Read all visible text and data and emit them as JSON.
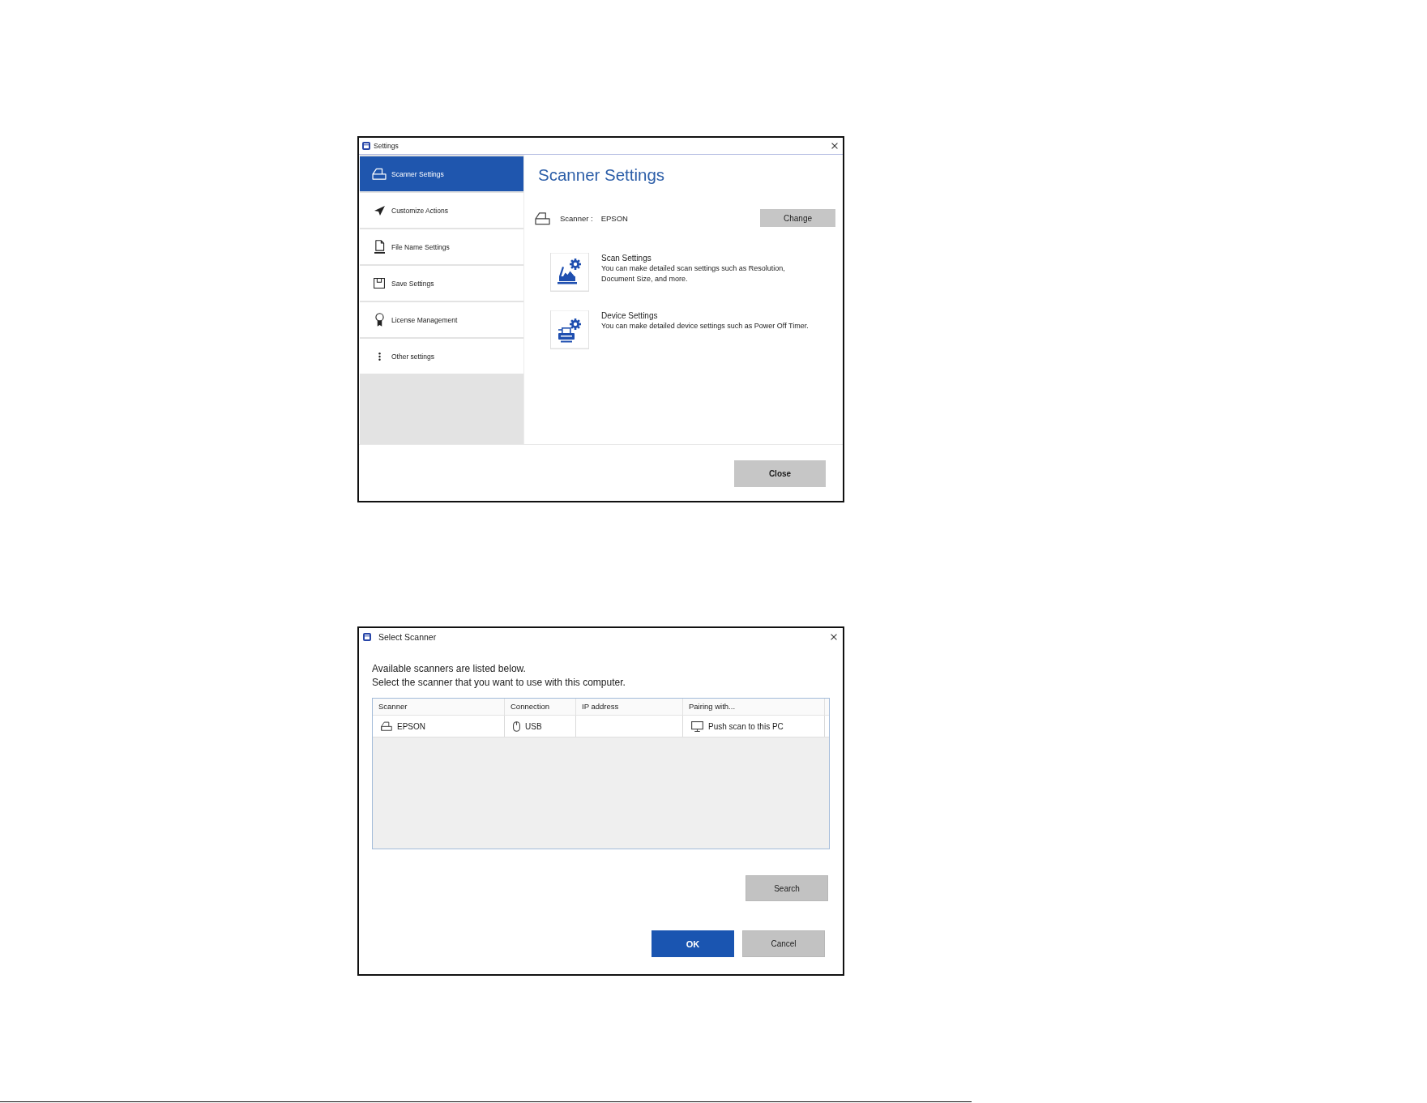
{
  "settings_window": {
    "title": "Settings",
    "sidebar": {
      "items": [
        {
          "kind": "scanner",
          "label": "Scanner Settings",
          "selected": true
        },
        {
          "kind": "actions",
          "label": "Customize Actions",
          "selected": false
        },
        {
          "kind": "file",
          "label": "File Name Settings",
          "selected": false
        },
        {
          "kind": "save",
          "label": "Save Settings",
          "selected": false
        },
        {
          "kind": "license",
          "label": "License Management",
          "selected": false
        },
        {
          "kind": "more",
          "label": "Other settings",
          "selected": false
        }
      ]
    },
    "heading": "Scanner Settings",
    "scanner": {
      "label": "Scanner :",
      "value": "EPSON"
    },
    "change_button": "Change",
    "options": [
      {
        "kind": "scan",
        "title": "Scan Settings",
        "description": "You can make detailed scan settings such as Resolution,\nDocument Size, and more."
      },
      {
        "kind": "device",
        "title": "Device Settings",
        "description": "You can make detailed device settings such as Power Off Timer."
      }
    ],
    "close_button": "Close"
  },
  "select_scanner_window": {
    "title": "Select Scanner",
    "instructions": [
      "Available scanners are listed below.",
      "Select the scanner that you want to use with this computer."
    ],
    "table": {
      "columns": [
        "Scanner",
        "Connection",
        "IP address",
        "Pairing with..."
      ],
      "rows": [
        {
          "scanner": "EPSON",
          "connection": "USB",
          "pairing": "Push scan to this PC",
          "selected": false
        }
      ]
    },
    "search_button": "Search",
    "buttons": [
      {
        "kind": "primary",
        "label": "OK"
      },
      {
        "kind": "secondary",
        "label": "Cancel"
      }
    ]
  }
}
